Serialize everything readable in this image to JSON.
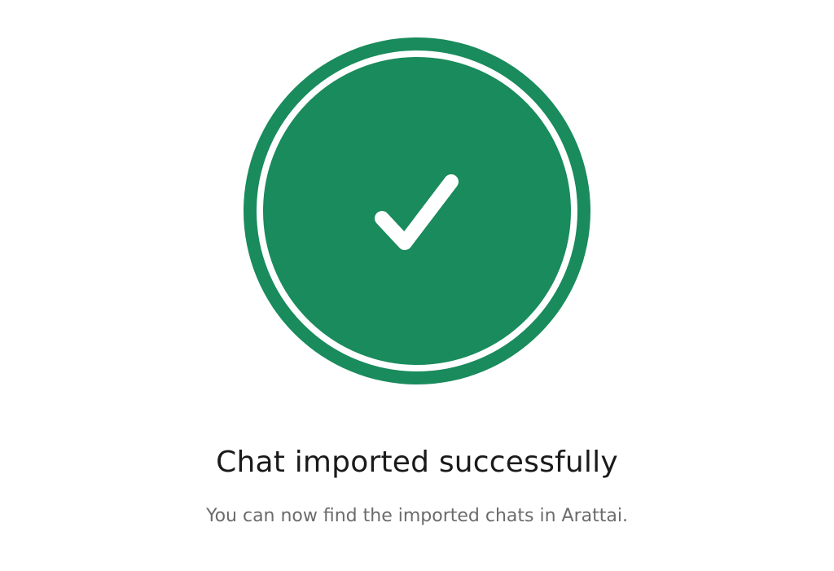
{
  "status": {
    "icon": "success-check-icon",
    "color": "#198b5c",
    "title": "Chat imported successfully",
    "message": "You can now find the imported chats in Arattai."
  }
}
